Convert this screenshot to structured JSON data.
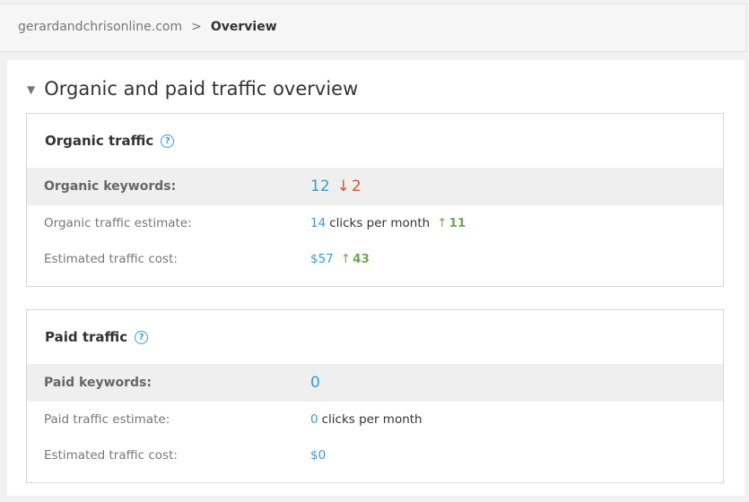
{
  "breadcrumb": {
    "domain": "gerardandchrisonline.com",
    "separator": ">",
    "current": "Overview"
  },
  "section": {
    "caret": "▼",
    "title": "Organic and paid traffic overview"
  },
  "organic": {
    "title": "Organic traffic",
    "help": "?",
    "keywords_label": "Organic keywords:",
    "keywords_value": "12",
    "keywords_change": "2",
    "keywords_change_arrow": "↓",
    "traffic_label": "Organic traffic estimate:",
    "traffic_value": "14",
    "traffic_unit": "clicks per month",
    "traffic_change": "11",
    "traffic_change_arrow": "↑",
    "cost_label": "Estimated traffic cost:",
    "cost_value": "$57",
    "cost_change": "43",
    "cost_change_arrow": "↑"
  },
  "paid": {
    "title": "Paid traffic",
    "help": "?",
    "keywords_label": "Paid keywords:",
    "keywords_value": "0",
    "traffic_label": "Paid traffic estimate:",
    "traffic_value": "0",
    "traffic_unit": "clicks per month",
    "cost_label": "Estimated traffic cost:",
    "cost_value": "$0"
  },
  "colors": {
    "accent": "#3a9ad9",
    "increase": "#6aa84f",
    "decrease": "#d9532a"
  }
}
